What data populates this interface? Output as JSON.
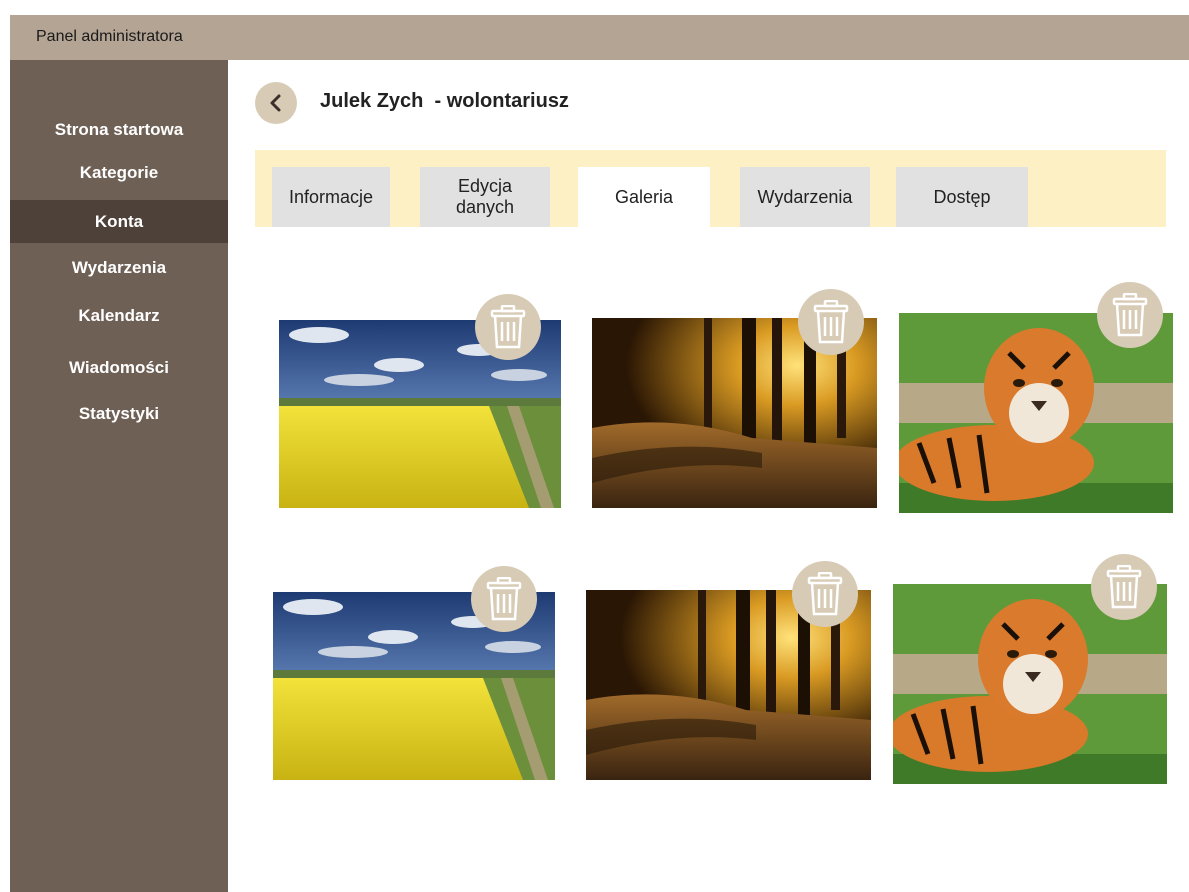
{
  "header": {
    "app_title": "Panel administratora"
  },
  "sidebar": {
    "items": [
      {
        "label": "Strona startowa",
        "active": false
      },
      {
        "label": "Kategorie",
        "active": false
      },
      {
        "label": "Konta",
        "active": true
      },
      {
        "label": "Wydarzenia",
        "active": false
      },
      {
        "label": "Kalendarz",
        "active": false
      },
      {
        "label": "Wiadomości",
        "active": false
      },
      {
        "label": "Statystyki",
        "active": false
      }
    ]
  },
  "profile": {
    "title": "Julek Zych  - wolontariusz",
    "back_icon": "chevron-left-icon"
  },
  "tabs": [
    {
      "label": "Informacje",
      "active": false
    },
    {
      "label": "Edycja danych",
      "active": false
    },
    {
      "label": "Galeria",
      "active": true
    },
    {
      "label": "Wydarzenia",
      "active": false
    },
    {
      "label": "Dostęp",
      "active": false
    }
  ],
  "gallery": {
    "photos": [
      {
        "subject": "rapeseed-field"
      },
      {
        "subject": "forest-sunset"
      },
      {
        "subject": "tiger"
      },
      {
        "subject": "rapeseed-field"
      },
      {
        "subject": "forest-sunset"
      },
      {
        "subject": "tiger"
      }
    ],
    "delete_icon": "trash-icon"
  },
  "colors": {
    "topbar": "#b3a494",
    "sidebar": "#6f6056",
    "sidebar_active": "#4e4139",
    "tabbar": "#fdf0c4",
    "tab_inactive": "#e1e1e1",
    "icon_circle": "#d7cbb6"
  }
}
